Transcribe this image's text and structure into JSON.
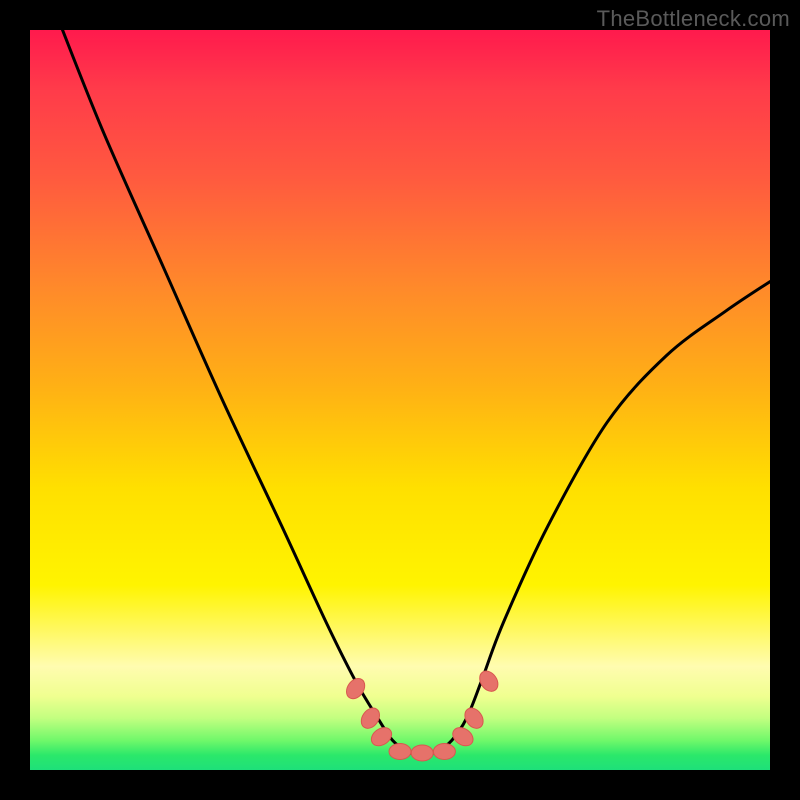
{
  "watermark": "TheBottleneck.com",
  "chart_data": {
    "type": "line",
    "title": "",
    "xlabel": "",
    "ylabel": "",
    "xlim": [
      0,
      100
    ],
    "ylim": [
      0,
      100
    ],
    "series": [
      {
        "name": "curve",
        "x": [
          4,
          10,
          18,
          26,
          34,
          40,
          44,
          47,
          49,
          51,
          53,
          55,
          57,
          59,
          61,
          64,
          70,
          78,
          86,
          94,
          100
        ],
        "y": [
          101,
          86,
          68,
          50,
          33,
          20,
          12,
          7,
          4,
          2.5,
          2,
          2.5,
          4,
          7,
          12,
          20,
          33,
          47,
          56,
          62,
          66
        ]
      }
    ],
    "markers": [
      {
        "x": 44,
        "y": 11
      },
      {
        "x": 46,
        "y": 7
      },
      {
        "x": 47.5,
        "y": 4.5
      },
      {
        "x": 50,
        "y": 2.5
      },
      {
        "x": 53,
        "y": 2.3
      },
      {
        "x": 56,
        "y": 2.5
      },
      {
        "x": 58.5,
        "y": 4.5
      },
      {
        "x": 60,
        "y": 7
      },
      {
        "x": 62,
        "y": 12
      }
    ],
    "gradient_stops": [
      {
        "pos": 0.0,
        "color": "#ff1a4d"
      },
      {
        "pos": 0.35,
        "color": "#ff8a2a"
      },
      {
        "pos": 0.62,
        "color": "#ffe000"
      },
      {
        "pos": 0.9,
        "color": "#f0ff90"
      },
      {
        "pos": 1.0,
        "color": "#1ee07a"
      }
    ]
  }
}
